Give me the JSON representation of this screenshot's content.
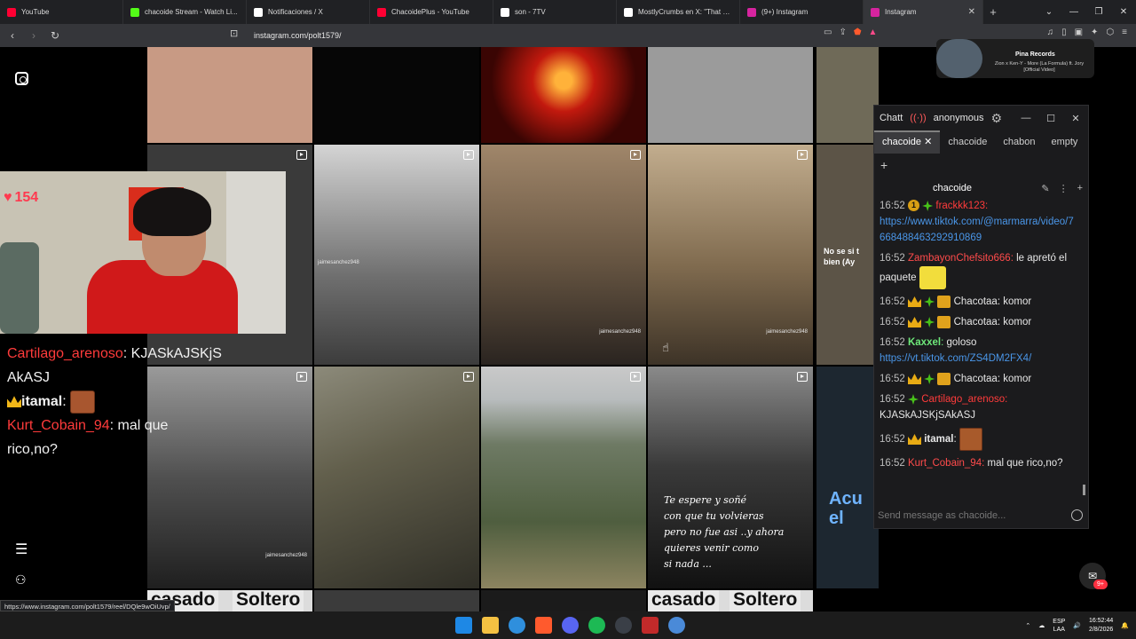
{
  "tabs": [
    {
      "label": "YouTube",
      "color": "#ff0033",
      "active": false
    },
    {
      "label": "chacoide Stream - Watch Li...",
      "color": "#53fc18",
      "active": false
    },
    {
      "label": "Notificaciones / X",
      "color": "#ffffff",
      "active": false
    },
    {
      "label": "ChacoidePlus - YouTube",
      "color": "#ff0033",
      "active": false
    },
    {
      "label": "son - 7TV",
      "color": "#ffffff",
      "active": false
    },
    {
      "label": "MostlyCrumbs en X: \"That sh...",
      "color": "#ffffff",
      "active": false
    },
    {
      "label": "(9+) Instagram",
      "color": "#d6249f",
      "active": false
    },
    {
      "label": "Instagram",
      "color": "#d6249f",
      "active": true
    }
  ],
  "address": {
    "url": "instagram.com/polt1579/"
  },
  "grid": {
    "watermark": "jaimesanchez948",
    "caption_lines": [
      "Te espere y soñé",
      "con que tu volvieras",
      "pero no fue asi ..y ahora",
      "quieres venir como",
      "si nada ..."
    ],
    "bottom_labels": [
      "casado",
      "Soltero",
      "casado",
      "Soltero"
    ],
    "side_text": [
      "No se si t",
      "bien (Ay"
    ],
    "side_blue_text": [
      "Acu",
      "el"
    ]
  },
  "overlay": {
    "heart_count": "154",
    "chat_lines": [
      {
        "user": "Cartilago_arenoso",
        "user_color": "#ff3b3b",
        "text": ": KJASkAJSKjS"
      },
      {
        "user": "",
        "user_color": "#f1f1f1",
        "text": "AkASJ"
      },
      {
        "user": "itamal",
        "user_color": "#f1f1f1",
        "text": ":"
      },
      {
        "user": "Kurt_Cobain_94",
        "user_color": "#ff3b3b",
        "text": ": mal que"
      },
      {
        "user": "",
        "user_color": "#f1f1f1",
        "text": "rico,no?"
      }
    ]
  },
  "chatterino": {
    "title": "Chatt",
    "account": "anonymous",
    "tabs": [
      "chacoide",
      "chacoide",
      "chabon",
      "empty"
    ],
    "split_name": "chacoide",
    "input_placeholder": "Send message as chacoide...",
    "messages": [
      {
        "time": "16:52",
        "user": "frackkk123",
        "user_color": "#ff3b3b",
        "text": "",
        "link": "https://www.tiktok.com/@marmarra/video/7668488463292910869"
      },
      {
        "time": "16:52",
        "user": "ZambayonChefsito666",
        "user_color": "#ff4b4b",
        "text": " le apretó el paquete",
        "link": ""
      },
      {
        "time": "16:52",
        "user": "Chacotaa",
        "user_color": "#d8d8d8",
        "text": " komor",
        "link": ""
      },
      {
        "time": "16:52",
        "user": "Chacotaa",
        "user_color": "#d8d8d8",
        "text": " komor",
        "link": ""
      },
      {
        "time": "16:52",
        "user": "Kaxxel",
        "user_color": "#6ee87a",
        "text": " goloso",
        "link": "https://vt.tiktok.com/ZS4DM2FX4/"
      },
      {
        "time": "16:52",
        "user": "Chacotaa",
        "user_color": "#d8d8d8",
        "text": " komor",
        "link": ""
      },
      {
        "time": "16:52",
        "user": "Cartilago_arenoso",
        "user_color": "#ff3b3b",
        "text": " KJASkAJSKjSAkASJ",
        "link": ""
      },
      {
        "time": "16:52",
        "user": "itamal",
        "user_color": "#f0f0f0",
        "text": "",
        "link": ""
      },
      {
        "time": "16:52",
        "user": "Kurt_Cobain_94",
        "user_color": "#ff4b4b",
        "text": " mal que rico,no?",
        "link": ""
      }
    ]
  },
  "media": {
    "title": "Pina Records",
    "subtitle": "Zion x Ken-Y - More (La Formula) ft. Jory [Official Video]"
  },
  "filter_badge": "9+",
  "status_url": "https://www.instagram.com/polt1579/reel/DQle9wOiUvp/",
  "taskbar": {
    "lang_top": "ESP",
    "lang_bottom": "LAA",
    "time": "16:52:44",
    "date": "2/8/2026"
  }
}
